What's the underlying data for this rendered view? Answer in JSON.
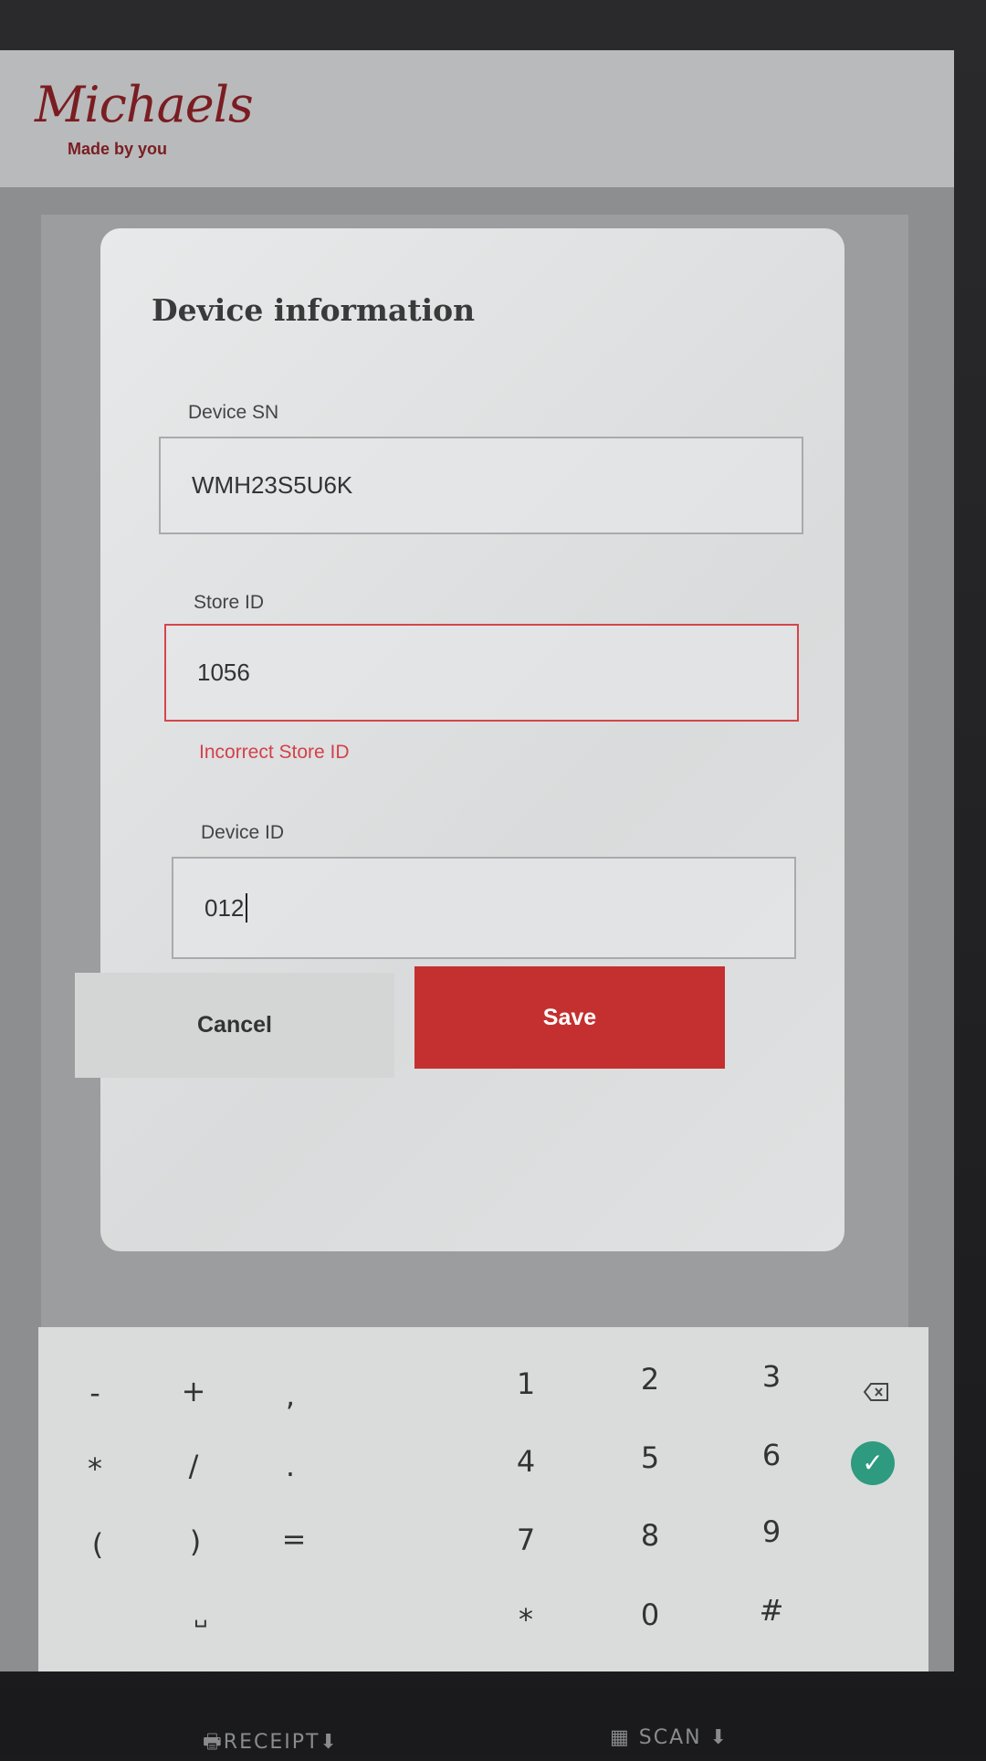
{
  "brand": {
    "wordmark": "Michaels",
    "tagline": "Made by you"
  },
  "dialog": {
    "title": "Device information",
    "fields": [
      {
        "label": "Device SN",
        "value": "WMH23S5U6K"
      },
      {
        "label": "Store ID",
        "value": "1056",
        "error": "Incorrect Store ID"
      },
      {
        "label": "Device ID",
        "value": "012"
      }
    ],
    "cancel_label": "Cancel",
    "save_label": "Save"
  },
  "keyboard": {
    "symbol_keys": [
      "-",
      "+",
      ",",
      "*",
      "/",
      ".",
      "(",
      ")",
      "=",
      "␣"
    ],
    "digit_keys": [
      "1",
      "2",
      "3",
      "4",
      "5",
      "6",
      "7",
      "8",
      "9",
      "*",
      "0",
      "#"
    ],
    "backspace_icon": "backspace-icon",
    "enter_icon": "check-icon",
    "accent_color": "#2e9a7f"
  },
  "nav_bar": {
    "icons": [
      "power-icon",
      "volume-down-icon",
      "back-icon",
      "home-icon",
      "recents-icon",
      "volume-up-icon",
      "collapse-icon"
    ]
  },
  "bezel": {
    "receipt_label": "RECEIPT",
    "scan_label": "SCAN"
  },
  "colors": {
    "primary": "#c4302f",
    "error": "#d44149",
    "brand": "#7a1d22"
  }
}
